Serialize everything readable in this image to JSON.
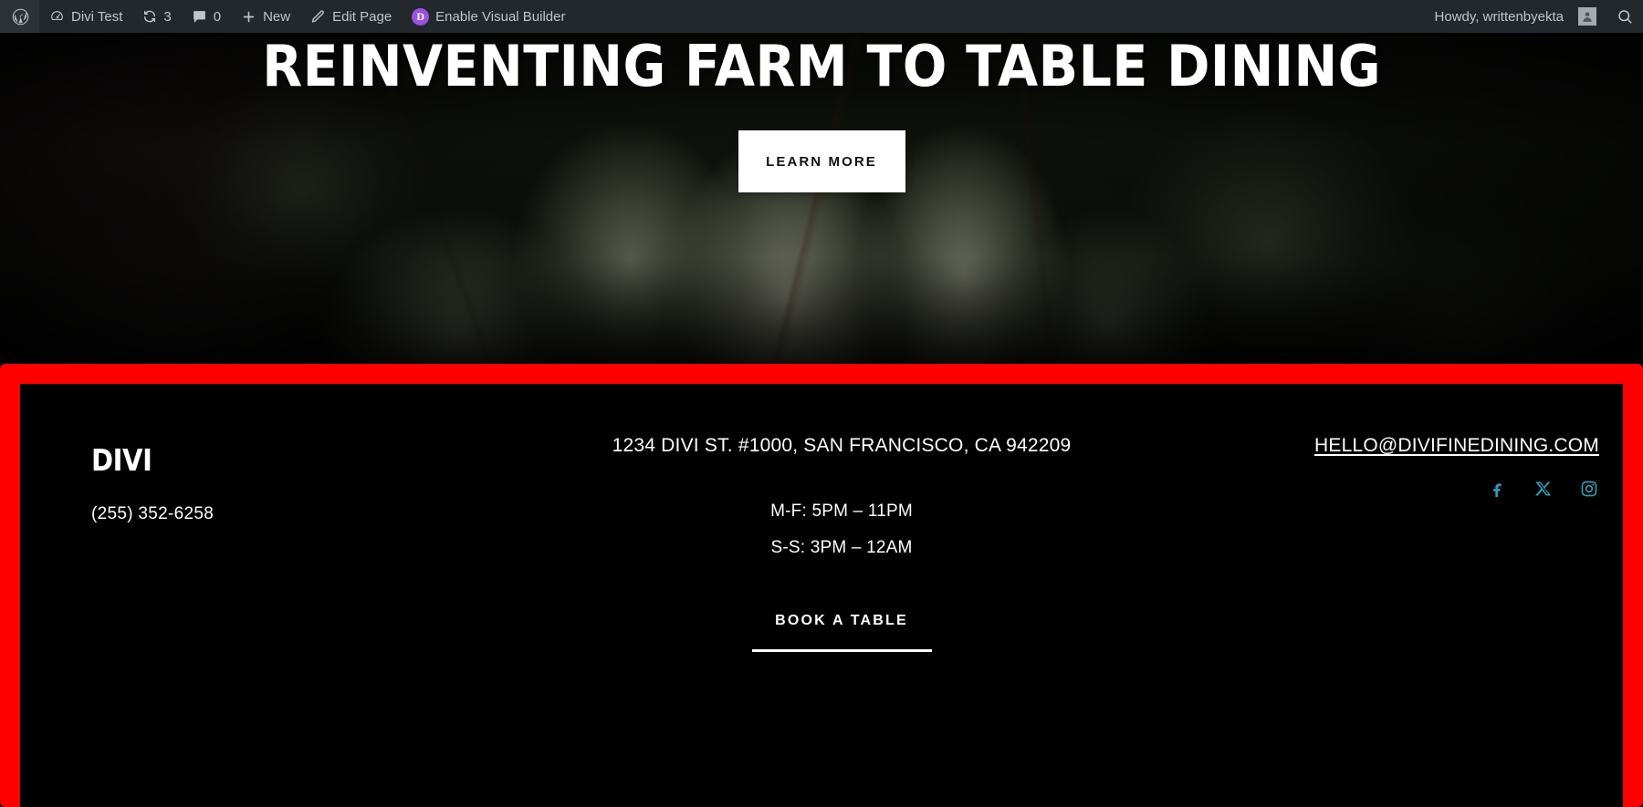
{
  "adminbar": {
    "wp_logo_icon": "wordpress-logo-icon",
    "site_icon": "dashboard-icon",
    "site_name": "Divi Test",
    "revisions_icon": "revisions-icon",
    "revisions_count": "3",
    "comments_icon": "comment-bubble-icon",
    "comments_count": "0",
    "new_icon": "plus-icon",
    "new_label": "New",
    "edit_icon": "pencil-icon",
    "edit_label": "Edit Page",
    "divi_icon": "divi-d-icon",
    "divi_icon_letter": "D",
    "divi_label": "Enable Visual Builder",
    "greeting": "Howdy, writtenbyekta",
    "avatar_icon": "user-avatar-icon",
    "search_icon": "search-icon",
    "bg_color": "#23282d",
    "text_color": "#c3c4c7",
    "divi_purple": "#9b51e0"
  },
  "hero": {
    "title": "Reinventing Farm to Table Dining",
    "cta_label": "Learn More",
    "cta_bg": "#ffffff",
    "cta_text_color": "#111111"
  },
  "footer": {
    "highlight_color": "#ff0000",
    "background": "#000000",
    "left": {
      "logo": "DIVI",
      "phone": "(255) 352-6258"
    },
    "middle": {
      "address": "1234 Divi St. #1000, San Francisco, CA 942209",
      "hours": [
        "M-F: 5PM – 11PM",
        "S-S: 3PM – 12AM"
      ],
      "book_label": "Book A Table"
    },
    "right": {
      "email": "HELLO@DIVIFINEDINING.COM",
      "social_color": "#2e9ab5",
      "socials": [
        {
          "name": "facebook-icon",
          "label": "Facebook"
        },
        {
          "name": "x-twitter-icon",
          "label": "X"
        },
        {
          "name": "instagram-icon",
          "label": "Instagram"
        }
      ]
    }
  }
}
